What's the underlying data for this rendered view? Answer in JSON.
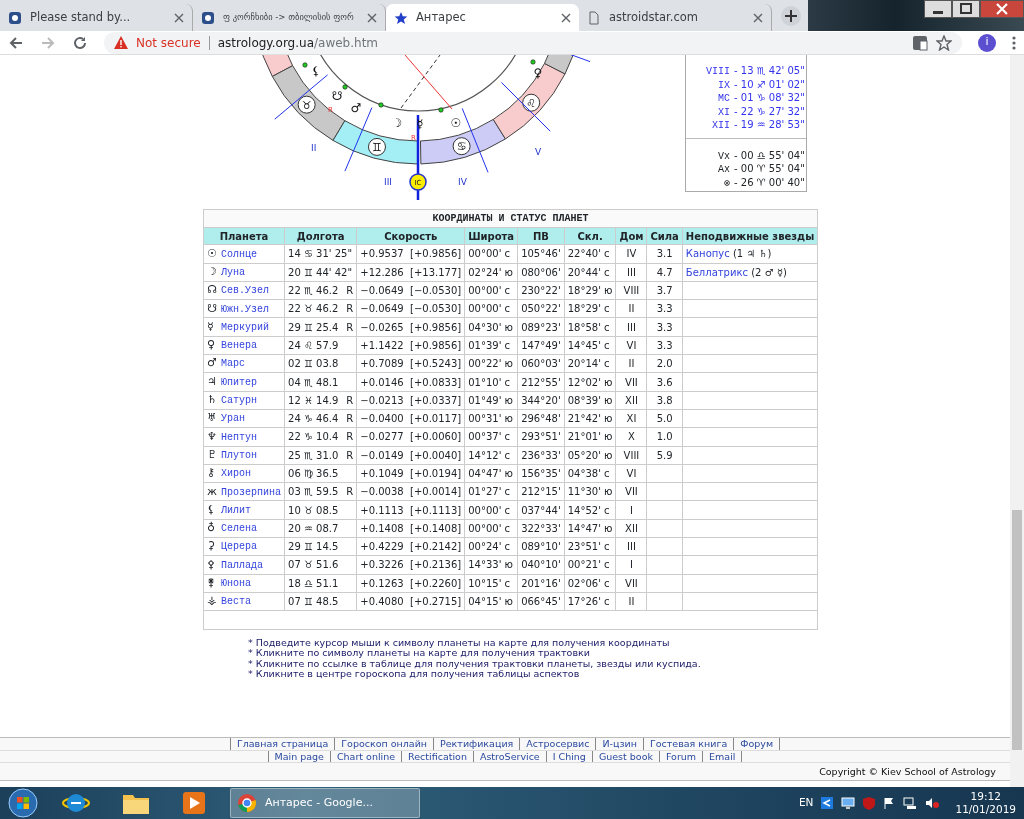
{
  "browser": {
    "tabs": [
      {
        "title": "Please stand by...",
        "kind": "logo",
        "selected": false
      },
      {
        "title": "ფ კორჩხიბი -> თბილისის ფორ",
        "kind": "logo",
        "selected": false
      },
      {
        "title": "Антарес",
        "kind": "star",
        "selected": true
      },
      {
        "title": "astroidstar.com",
        "kind": "page",
        "selected": false
      }
    ],
    "address": {
      "security": "Not secure",
      "host": "astrology.org.ua",
      "path": "/aweb.htm"
    },
    "profile_initial": "i"
  },
  "wheel": {
    "signs": [
      {
        "color": "#f8cccc"
      },
      {
        "glyph": "♉",
        "color": "#c8c8c8"
      },
      {
        "glyph": "♊",
        "color": "#a4eef6"
      },
      {
        "glyph": "♋",
        "color": "#ccccf6"
      },
      {
        "glyph": "♌",
        "color": "#f8cccc"
      },
      {
        "color": "#c8c8c8"
      }
    ],
    "planets": [
      {
        "glyph": "⚸"
      },
      {
        "glyph": "☋",
        "motion": "R"
      },
      {
        "glyph": "♂"
      },
      {
        "glyph": "☽"
      },
      {
        "glyph": "☿",
        "motion": "R"
      },
      {
        "glyph": "☉"
      },
      {
        "glyph": "♀"
      }
    ],
    "houses": [
      "II",
      "III",
      "IV",
      "V"
    ],
    "ic_label": "IC"
  },
  "cusps": [
    {
      "label": "VIII",
      "value": "- 13 ♏ 42' 05\""
    },
    {
      "label": "IX",
      "value": "- 10 ♐ 01' 02\""
    },
    {
      "label": "MC",
      "value": "- 01 ♑ 08' 32\""
    },
    {
      "label": "XI",
      "value": "- 22 ♑ 27' 32\""
    },
    {
      "label": "XII",
      "value": "- 19 ♒ 28' 53\""
    }
  ],
  "points": [
    {
      "label": "Vx",
      "value": "- 00 ♎ 55' 04\""
    },
    {
      "label": "Ax",
      "value": "- 00 ♈ 55' 04\""
    },
    {
      "label": "⊗",
      "value": "- 26 ♈ 00' 40\""
    }
  ],
  "table": {
    "title": "КООРДИНАТЫ И СТАТУС ПЛАНЕТ",
    "columns": [
      "Планета",
      "Долгота",
      "Скорость",
      "Широта",
      "ПВ",
      "Скл.",
      "Дом",
      "Сила",
      "Неподвижные звезды"
    ],
    "rows": [
      {
        "glyph": "☉",
        "name": "Солнце",
        "longitude": "14 ♋ 31' 25\"",
        "speed": "+0.9537  [+0.9856]",
        "latitude": "00°00' с",
        "ra": "105°46'",
        "declination": "22°40' с",
        "house": "IV",
        "strength": "3.1",
        "star": {
          "name": "Канопус",
          "detail": "(1 ♃ ♄)"
        }
      },
      {
        "glyph": "☽",
        "name": "Луна",
        "longitude": "20 ♊ 44' 42\"",
        "speed": "+12.286  [+13.177]",
        "latitude": "02°24' ю",
        "ra": "080°06'",
        "declination": "20°44' с",
        "house": "III",
        "strength": "4.7",
        "star": {
          "name": "Беллатрикс",
          "detail": "(2 ♂ ☿)"
        }
      },
      {
        "glyph": "☊",
        "name": "Сев.Узел",
        "longitude": "22 ♏ 46.2",
        "motion": "R",
        "speed": "−0.0649  [−0.0530]",
        "latitude": "00°00' с",
        "ra": "230°22'",
        "declination": "18°29' ю",
        "house": "VIII",
        "strength": "3.7"
      },
      {
        "glyph": "☋",
        "name": "Южн.Узел",
        "longitude": "22 ♉ 46.2",
        "motion": "R",
        "speed": "−0.0649  [−0.0530]",
        "latitude": "00°00' с",
        "ra": "050°22'",
        "declination": "18°29' с",
        "house": "II",
        "strength": "3.3"
      },
      {
        "glyph": "☿",
        "name": "Меркурий",
        "longitude": "29 ♊ 25.4",
        "motion": "R",
        "speed": "−0.0265  [+0.9856]",
        "latitude": "04°30' ю",
        "ra": "089°23'",
        "declination": "18°58' с",
        "house": "III",
        "strength": "3.3"
      },
      {
        "glyph": "♀",
        "name": "Венера",
        "longitude": "24 ♌ 57.9",
        "speed": "+1.1422  [+0.9856]",
        "latitude": "01°39' с",
        "ra": "147°49'",
        "declination": "14°45' с",
        "house": "VI",
        "strength": "3.3"
      },
      {
        "glyph": "♂",
        "name": "Марс",
        "longitude": "02 ♊ 03.8",
        "speed": "+0.7089  [+0.5243]",
        "latitude": "00°22' ю",
        "ra": "060°03'",
        "declination": "20°14' с",
        "house": "II",
        "strength": "2.0"
      },
      {
        "glyph": "♃",
        "name": "Юпитер",
        "longitude": "04 ♏ 48.1",
        "speed": "+0.0146  [+0.0833]",
        "latitude": "01°10' с",
        "ra": "212°55'",
        "declination": "12°02' ю",
        "house": "VII",
        "strength": "3.6"
      },
      {
        "glyph": "♄",
        "name": "Сатурн",
        "longitude": "12 ♓ 14.9",
        "motion": "R",
        "speed": "−0.0213  [+0.0337]",
        "latitude": "01°49' ю",
        "ra": "344°20'",
        "declination": "08°39' ю",
        "house": "XII",
        "strength": "3.8"
      },
      {
        "glyph": "♅",
        "name": "Уран",
        "longitude": "24 ♑ 46.4",
        "motion": "R",
        "speed": "−0.0400  [+0.0117]",
        "latitude": "00°31' ю",
        "ra": "296°48'",
        "declination": "21°42' ю",
        "house": "XI",
        "strength": "5.0"
      },
      {
        "glyph": "♆",
        "name": "Нептун",
        "longitude": "22 ♑ 10.4",
        "motion": "R",
        "speed": "−0.0277  [+0.0060]",
        "latitude": "00°37' с",
        "ra": "293°51'",
        "declination": "21°01' ю",
        "house": "X",
        "strength": "1.0"
      },
      {
        "glyph": "♇",
        "name": "Плутон",
        "longitude": "25 ♏ 31.0",
        "motion": "R",
        "speed": "−0.0149  [+0.0040]",
        "latitude": "14°12' с",
        "ra": "236°33'",
        "declination": "05°20' ю",
        "house": "VIII",
        "strength": "5.9"
      },
      {
        "glyph": "⚷",
        "name": "Хирон",
        "longitude": "06 ♍ 36.5",
        "speed": "+0.1049  [+0.0194]",
        "latitude": "04°47' ю",
        "ra": "156°35'",
        "declination": "04°38' с",
        "house": "VI"
      },
      {
        "glyph": "ж",
        "name": "Прозерпина",
        "longitude": "03 ♏ 59.5",
        "motion": "R",
        "speed": "−0.0038  [+0.0014]",
        "latitude": "01°27' с",
        "ra": "212°15'",
        "declination": "11°30' ю",
        "house": "VII"
      },
      {
        "glyph": "⚸",
        "name": "Лилит",
        "longitude": "10 ♉ 08.5",
        "speed": "+0.1113  [+0.1113]",
        "latitude": "00°00' с",
        "ra": "037°44'",
        "declination": "14°52' с",
        "house": "I"
      },
      {
        "glyph": "♁",
        "name": "Селена",
        "longitude": "20 ♒ 08.7",
        "speed": "+0.1408  [+0.1408]",
        "latitude": "00°00' с",
        "ra": "322°33'",
        "declination": "14°47' ю",
        "house": "XII"
      },
      {
        "glyph": "⚳",
        "name": "Церера",
        "longitude": "29 ♊ 14.5",
        "speed": "+0.4229  [+0.2142]",
        "latitude": "00°24' с",
        "ra": "089°10'",
        "declination": "23°51' с",
        "house": "III"
      },
      {
        "glyph": "⚴",
        "name": "Паллада",
        "longitude": "07 ♉ 51.6",
        "speed": "+0.3226  [+0.2136]",
        "latitude": "14°33' ю",
        "ra": "040°10'",
        "declination": "00°21' с",
        "house": "I"
      },
      {
        "glyph": "⚵",
        "name": "Юнона",
        "longitude": "18 ♎ 51.1",
        "speed": "+0.1263  [+0.2260]",
        "latitude": "10°15' с",
        "ra": "201°16'",
        "declination": "02°06' с",
        "house": "VII"
      },
      {
        "glyph": "⚶",
        "name": "Веста",
        "longitude": "07 ♊ 48.5",
        "speed": "+0.4080  [+0.2715]",
        "latitude": "04°15' ю",
        "ra": "066°45'",
        "declination": "17°26' с",
        "house": "II"
      }
    ]
  },
  "notes": [
    "* Подведите курсор мыши к символу планеты на карте для получения координаты",
    "* Кликните по символу планеты на карте для получения трактовки",
    "* Кликните по ссылке в таблице для получения трактовки планеты, звезды или куспида.",
    "* Кликните в центре гороскопа для получения таблицы аспектов"
  ],
  "footer": {
    "nav_ru": [
      "Главная страница",
      "Гороскоп онлайн",
      "Ректификация",
      "Астросервис",
      "И-цзин",
      "Гостевая книга",
      "Форум"
    ],
    "nav_en": [
      "Main page",
      "Chart online",
      "Rectification",
      "AstroService",
      "I Ching",
      "Guest book",
      "Forum",
      "Email"
    ],
    "copyright": "Copyright  ©  Kiev School of Astrology"
  },
  "taskbar": {
    "apps": [
      {
        "kind": "ie"
      },
      {
        "kind": "folder"
      },
      {
        "kind": "media"
      }
    ],
    "task": "Антарес - Google...",
    "language": "EN",
    "time": "19:12",
    "date": "11/01/2019"
  }
}
